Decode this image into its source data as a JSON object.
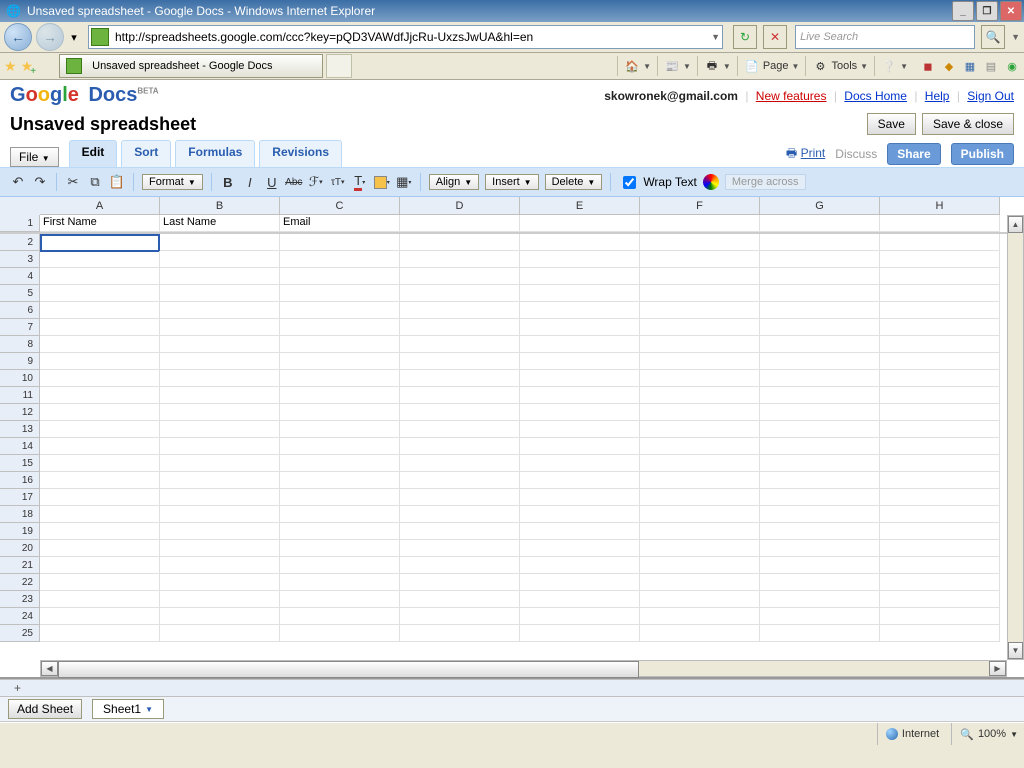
{
  "window": {
    "title": "Unsaved spreadsheet - Google Docs - Windows Internet Explorer"
  },
  "browser": {
    "url": "http://spreadsheets.google.com/ccc?key=pQD3VAWdfJjcRu-UxzsJwUA&hl=en",
    "search_placeholder": "Live Search",
    "tab_title": "Unsaved spreadsheet - Google Docs",
    "tools": {
      "page": "Page",
      "tools": "Tools"
    }
  },
  "header": {
    "email": "skowronek@gmail.com",
    "links": {
      "new_features": "New features",
      "docs_home": "Docs Home",
      "help": "Help",
      "sign_out": "Sign Out"
    }
  },
  "doc": {
    "title": "Unsaved spreadsheet"
  },
  "buttons": {
    "save": "Save",
    "save_close": "Save & close",
    "file": "File",
    "add_sheet": "Add Sheet"
  },
  "tabs": {
    "edit": "Edit",
    "sort": "Sort",
    "formulas": "Formulas",
    "revisions": "Revisions"
  },
  "right": {
    "print": "Print",
    "discuss": "Discuss",
    "share": "Share",
    "publish": "Publish"
  },
  "toolbar": {
    "format": "Format",
    "align": "Align",
    "insert": "Insert",
    "delete": "Delete",
    "wrap": "Wrap Text",
    "merge": "Merge across"
  },
  "grid": {
    "columns": [
      "A",
      "B",
      "C",
      "D",
      "E",
      "F",
      "G",
      "H"
    ],
    "rows": 25,
    "data": {
      "1": {
        "A": "First Name",
        "B": "Last Name",
        "C": "Email"
      }
    },
    "active_cell": "A2"
  },
  "sheets": {
    "tab1": "Sheet1"
  },
  "status": {
    "zone": "Internet",
    "zoom": "100%"
  }
}
